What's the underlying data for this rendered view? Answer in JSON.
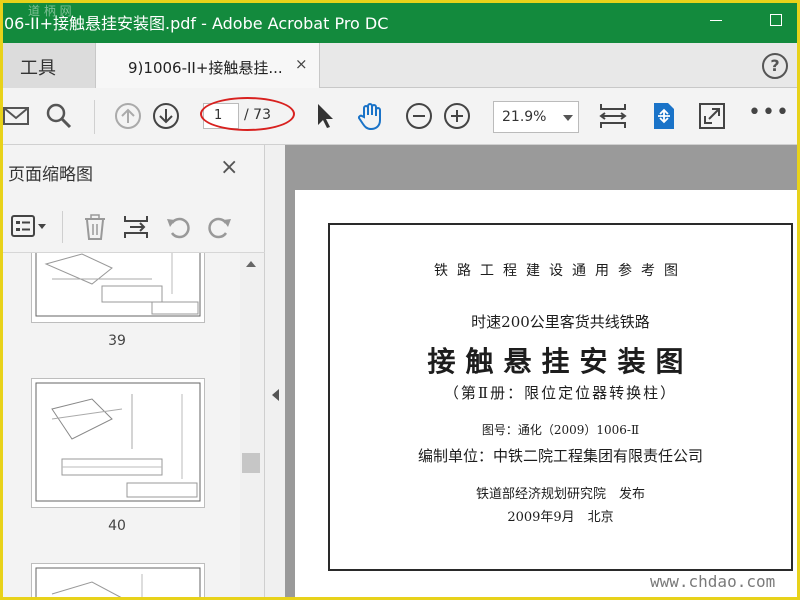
{
  "window": {
    "title": "06-II+接触悬挂安装图.pdf - Adobe Acrobat Pro DC",
    "watermark_top": "道 柄 网",
    "colors": {
      "titlebar": "#138a3d",
      "frame": "#e8d21a",
      "annotation_oval": "#d8211f",
      "accent": "#1a73c8"
    }
  },
  "tabs": {
    "tools_label": "工具",
    "doc_label": "9)1006-II+接触悬挂...",
    "close_glyph": "×",
    "help_glyph": "?"
  },
  "toolbar": {
    "current_page": "1",
    "total_pages": "/ 73",
    "zoom": "21.9%",
    "icons": [
      "email-icon",
      "search-icon",
      "page-up-icon",
      "page-down-icon",
      "pointer-icon",
      "hand-icon",
      "zoom-out-icon",
      "zoom-in-icon",
      "fit-page-icon",
      "scroll-mode-icon",
      "fullscreen-icon",
      "more-icon"
    ]
  },
  "panel": {
    "title": "页面缩略图",
    "close_glyph": "×",
    "thumbnails": [
      {
        "label": "39"
      },
      {
        "label": "40"
      }
    ]
  },
  "document": {
    "line1": "铁路工程建设通用参考图",
    "line2": "时速200公里客货共线铁路",
    "line3": "接触悬挂安装图",
    "line4": "（第Ⅱ册：限位定位器转换柱）",
    "line5": "图号：通化（2009）1006-Ⅱ",
    "line6": "编制单位：中铁二院工程集团有限责任公司",
    "line7": "铁道部经济规划研究院　发布",
    "line8": "2009年9月　北京"
  },
  "watermark": "www.chdao.com"
}
